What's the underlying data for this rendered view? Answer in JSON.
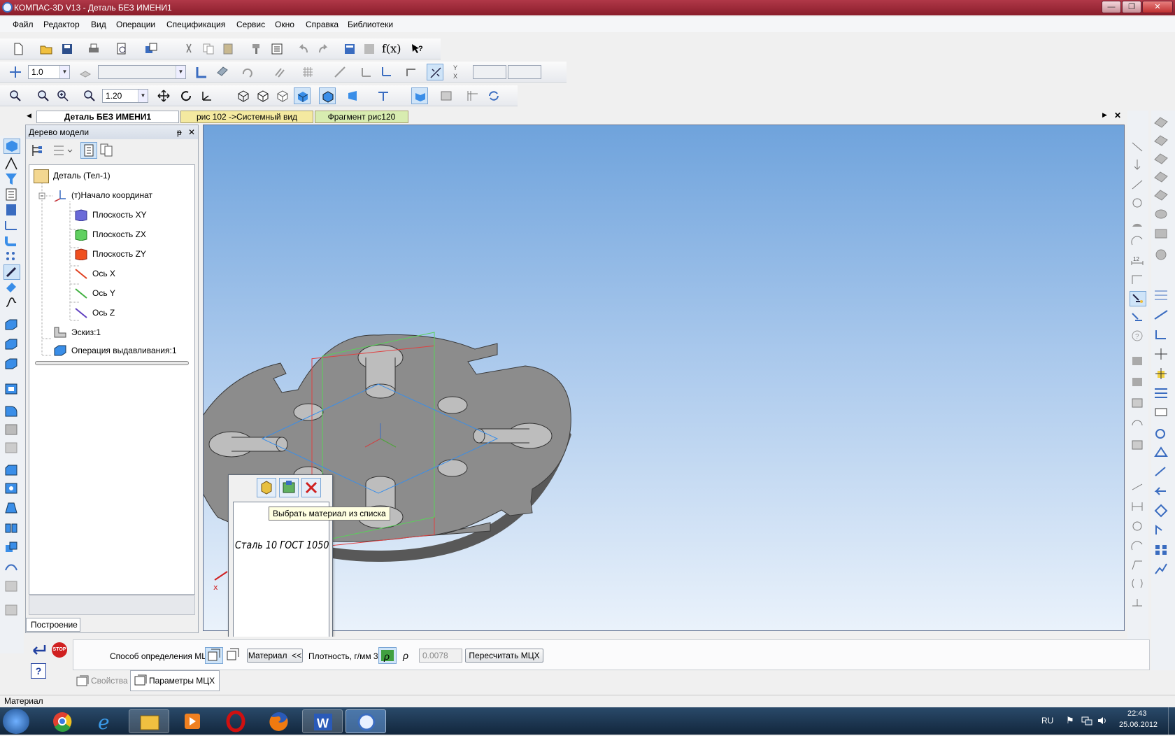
{
  "window": {
    "title": "КОМПАС-3D V13 - Деталь БЕЗ ИМЕНИ1",
    "minimize": "—",
    "restore": "❐",
    "close": "✕"
  },
  "menu": [
    "Файл",
    "Редактор",
    "Вид",
    "Операции",
    "Спецификация",
    "Сервис",
    "Окно",
    "Справка",
    "Библиотеки"
  ],
  "toolbar2": {
    "step_value": "1.0",
    "style_value": ""
  },
  "toolbar3": {
    "zoom_value": "1.20"
  },
  "doc_tabs": [
    "Деталь БЕЗ ИМЕНИ1",
    "рис 102 ->Системный вид",
    "Фрагмент рис120"
  ],
  "tree": {
    "title": "Дерево модели",
    "pin": "ᵽ",
    "close": "✕",
    "nodes": [
      "Деталь (Тел-1)",
      "(т)Начало координат",
      "Плоскость XY",
      "Плоскость ZX",
      "Плоскость ZY",
      "Ось X",
      "Ось Y",
      "Ось Z",
      "Эскиз:1",
      "Операция выдавливания:1"
    ],
    "bottom_tab": "Построение"
  },
  "material_dialog": {
    "tooltip": "Выбрать материал из списка",
    "material_text": "Сталь 10 ГОСТ 1050"
  },
  "properties": {
    "stop_label": "STOP",
    "help_label": "?",
    "mcx_method_label": "Способ определения МЦХ",
    "material_button": "Материал",
    "material_collapse": "<<",
    "density_label": "Плотность, г/мм 3",
    "density_value": "0.0078",
    "recalc_button": "Пересчитать МЦХ",
    "tab_properties": "Свойства",
    "tab_mcx": "Параметры МЦХ"
  },
  "status_text": "Материал",
  "taskbar": {
    "lang": "RU",
    "time": "22:43",
    "date": "25.06.2012"
  },
  "colors": {
    "titlebar": "#9a2636",
    "viewport_top": "#6fa3dc",
    "part": "#8c8c8c",
    "accent": "#3a6cc0"
  }
}
